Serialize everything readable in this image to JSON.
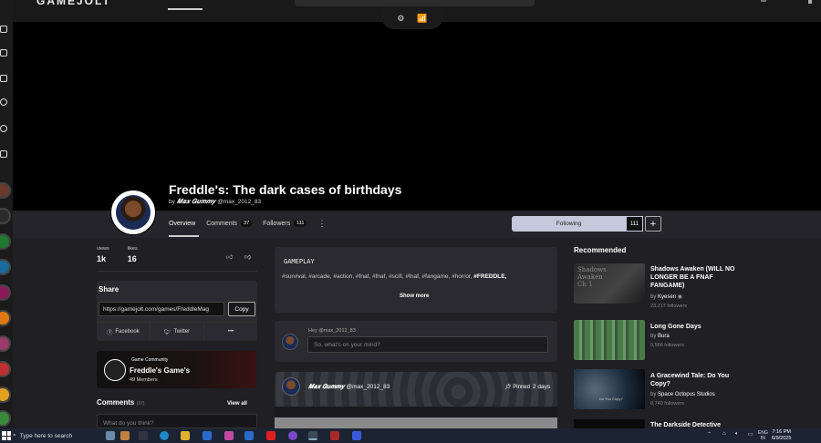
{
  "game": {
    "title": "Freddle's: The dark cases of birthdays",
    "by": "by",
    "developer_display": "𝑴𝒂𝒙 𝑮𝒖𝒎𝒎𝒚",
    "developer_handle": "@max_2012_83"
  },
  "tabs": [
    {
      "label": "Overview"
    },
    {
      "label": "Comments",
      "count": "37"
    },
    {
      "label": "Followers",
      "count": "111"
    }
  ],
  "follow": {
    "label": "Following",
    "count": "111",
    "plus": "+"
  },
  "stats": {
    "views_label": "views",
    "views": "1k",
    "likes_label": "likes",
    "likes": "16"
  },
  "share": {
    "title": "Share",
    "url": "https://gamejolt.com/games/FreddleMag",
    "copy": "Copy",
    "facebook": "Facebook",
    "twitter": "Twitter",
    "more": "•••"
  },
  "community": {
    "tag": "Game Community",
    "name": "Freddle's Game's",
    "members": "49 Members"
  },
  "comments": {
    "title": "Comments",
    "count": "(37)",
    "view_all": "View all",
    "placeholder": "What do you think?"
  },
  "description": {
    "heading": "GAMEPLAY",
    "tags": "#survival, #arcade, #action, #fnaf, #fnaf, #scifi, #fnaf, #fangame, #horror,",
    "tag_bold": "#FREDDLE,",
    "show_more": "Show more"
  },
  "post": {
    "greeting": "Hey @max_2012_83",
    "placeholder": "So, what's on your mind?"
  },
  "feed": {
    "author": "𝑴𝒂𝒙 𝑮𝒖𝒎𝒎𝒚",
    "handle": "@max_2012_83",
    "pinned": "Pinned",
    "age": "2 days"
  },
  "recommended": {
    "title": "Recommended",
    "items": [
      {
        "name": "Shadows Awaken (WILL NO LONGER BE A FNAF FANGAME)",
        "by": "by",
        "dev": "Kyesen",
        "followers": "23,217 followers",
        "thumb_text": "Shadows\nAwaken\nCh 1"
      },
      {
        "name": "Long Gone Days",
        "by": "by",
        "dev": "Bura",
        "followers": "9,586 followers"
      },
      {
        "name": "A Gracewind Tale: Do You Copy?",
        "by": "by",
        "dev": "Space Octopus Studios",
        "followers": "8,740 followers",
        "thumb_text": "Do You Copy?"
      },
      {
        "name": "The Darkside Detective"
      }
    ]
  },
  "taskbar": {
    "search": "Type here to search",
    "lang1": "ENG",
    "lang2": "IN",
    "time": "7:16 PM",
    "date": "6/9/2025"
  },
  "colors": {
    "accent": "#c4c8da",
    "page_bg": "#1f1f24",
    "card_bg": "#2a2a30"
  }
}
